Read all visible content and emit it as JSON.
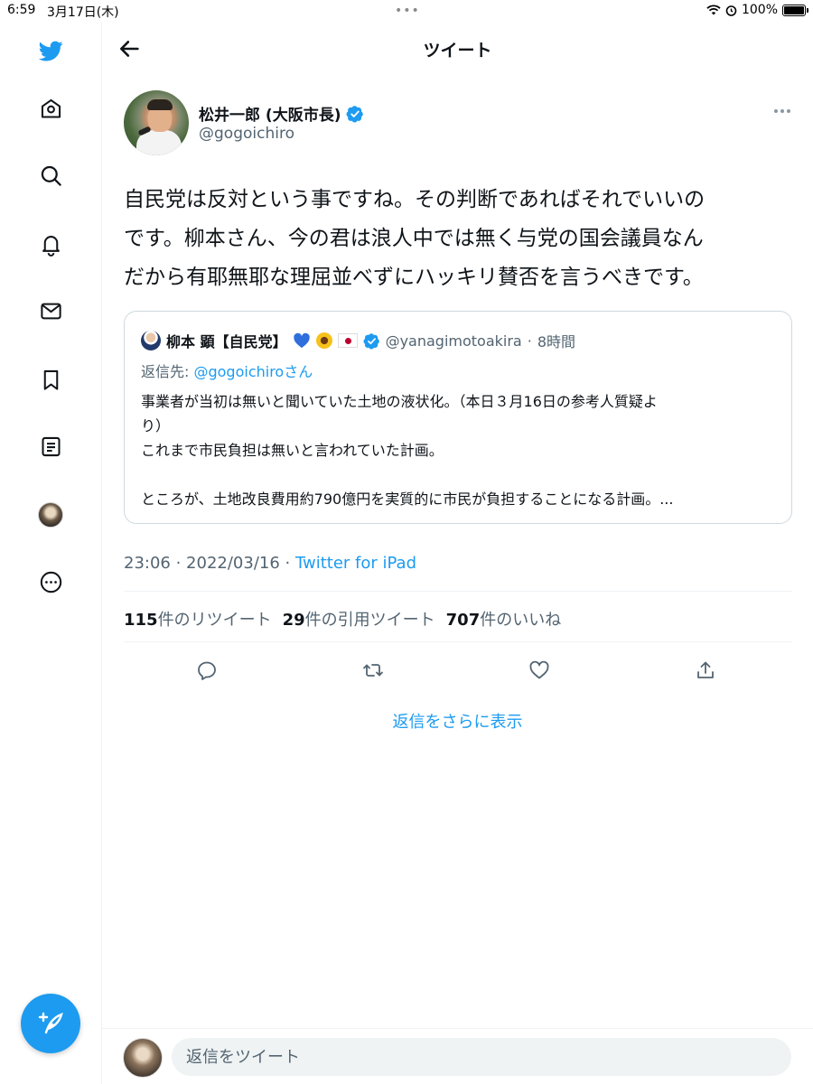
{
  "status_bar": {
    "time": "6:59",
    "date": "3月17日(木)",
    "battery": "100%",
    "battery_level": 1.0
  },
  "sidebar": {
    "items": [
      {
        "name": "home",
        "icon": "home-icon"
      },
      {
        "name": "explore",
        "icon": "search-icon"
      },
      {
        "name": "notifications",
        "icon": "bell-icon"
      },
      {
        "name": "messages",
        "icon": "mail-icon"
      },
      {
        "name": "bookmarks",
        "icon": "bookmark-icon"
      },
      {
        "name": "lists",
        "icon": "list-icon"
      },
      {
        "name": "profile",
        "icon": "avatar"
      },
      {
        "name": "more",
        "icon": "more-circle-icon"
      }
    ],
    "compose_icon": "compose-icon"
  },
  "header": {
    "title": "ツイート",
    "back_icon": "back-arrow-icon"
  },
  "tweet": {
    "display_name": "松井一郎 (大阪市長)",
    "handle": "@gogoichiro",
    "text_lines": [
      "自民党は反対という事ですね。その判断であればそれでいいの",
      "です。柳本さん、今の君は浪人中では無く与党の国会議員なん",
      "だから有耶無耶な理屈並べずにハッキリ賛否を言うべきです。"
    ],
    "time": "23:06",
    "date": "2022/03/16",
    "source": "Twitter for iPad",
    "retweets": "115",
    "retweets_label": "件のリツイート",
    "quotes": "29",
    "quotes_label": "件の引用ツイート",
    "likes": "707",
    "likes_label": "件のいいね"
  },
  "quoted_tweet": {
    "display_name": "柳本 顕【自民党】",
    "handle": "@yanagimotoakira",
    "age": "8時間",
    "reply_prefix": "返信先: ",
    "reply_to": "@gogoichiro",
    "reply_suffix": "さん",
    "body_lines": [
      "事業者が当初は無いと聞いていた土地の液状化。（本日３月16日の参考人質疑よ",
      "り）",
      "これまで市民負担は無いと言われていた計画。",
      "",
      "ところが、土地改良費用約790億円を実質的に市民が負担することになる計画。..."
    ]
  },
  "more_replies": "返信をさらに表示",
  "reply_bar": {
    "placeholder": "返信をツイート"
  },
  "colors": {
    "accent": "#1d9bf0",
    "text": "#0f1419",
    "secondary": "#536471",
    "border": "#cfd9de"
  }
}
